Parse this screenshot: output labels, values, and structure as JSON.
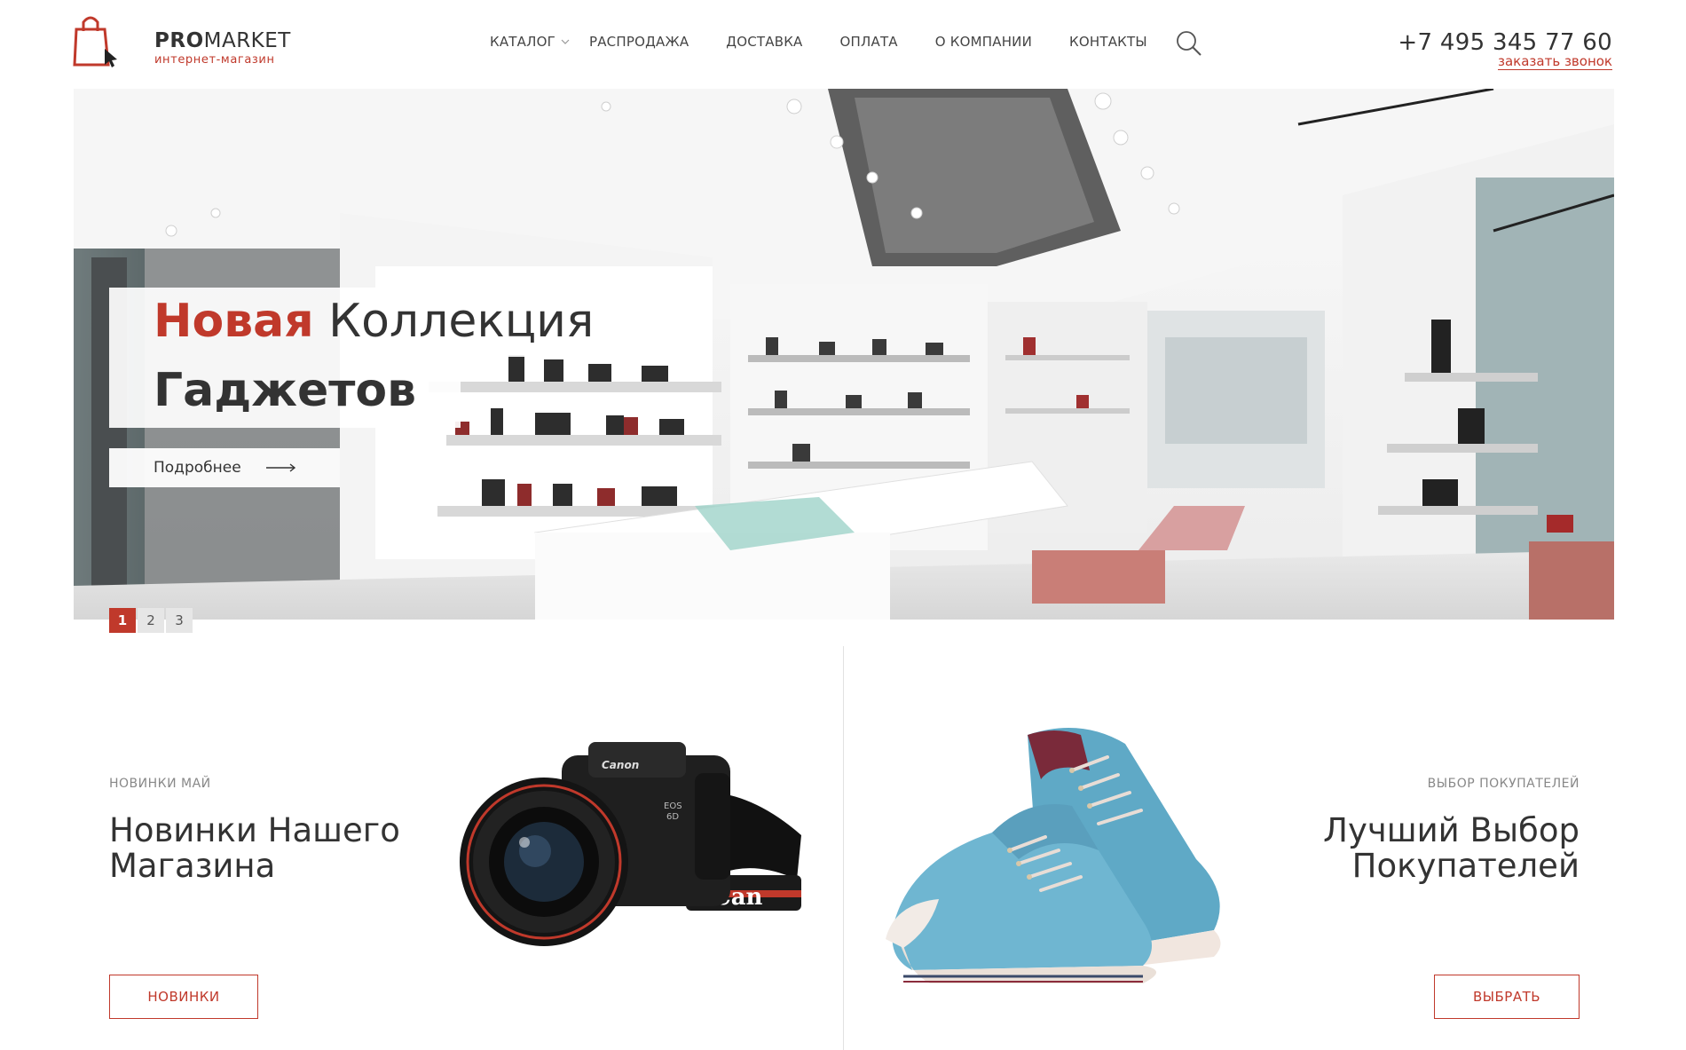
{
  "header": {
    "logo": {
      "brand_bold": "PRO",
      "brand_light": "MARKET",
      "tagline": "интернет-магазин"
    },
    "nav": [
      {
        "label": "КАТАЛОГ",
        "has_dropdown": true
      },
      {
        "label": "РАСПРОДАЖА"
      },
      {
        "label": "ДОСТАВКА"
      },
      {
        "label": "ОПЛАТА"
      },
      {
        "label": "О КОМПАНИИ"
      },
      {
        "label": "КОНТАКТЫ"
      }
    ],
    "search_icon": "search-icon",
    "phone": "+7 495 345 77 60",
    "callback_label": "заказать звонок"
  },
  "hero": {
    "title_accent": "Новая",
    "title_rest": "Коллекция",
    "title_line2": "Гаджетов",
    "more_label": "Подробнее",
    "slides": [
      "1",
      "2",
      "3"
    ],
    "active_slide": 1
  },
  "promos": {
    "left": {
      "kicker": "НОВИНКИ МАЙ",
      "title_line1": "Новинки Нашего",
      "title_line2": "Магазина",
      "button": "НОВИНКИ",
      "image": "camera"
    },
    "right": {
      "kicker": "ВЫБОР ПОКУПАТЕЛЕЙ",
      "title_line1": "Лучший Выбор",
      "title_line2": "Покупателей",
      "button": "ВЫБРАТЬ",
      "image": "sneakers"
    }
  },
  "colors": {
    "accent": "#c0392b",
    "text": "#333333",
    "muted": "#888888",
    "divider": "#e2e2e2"
  }
}
